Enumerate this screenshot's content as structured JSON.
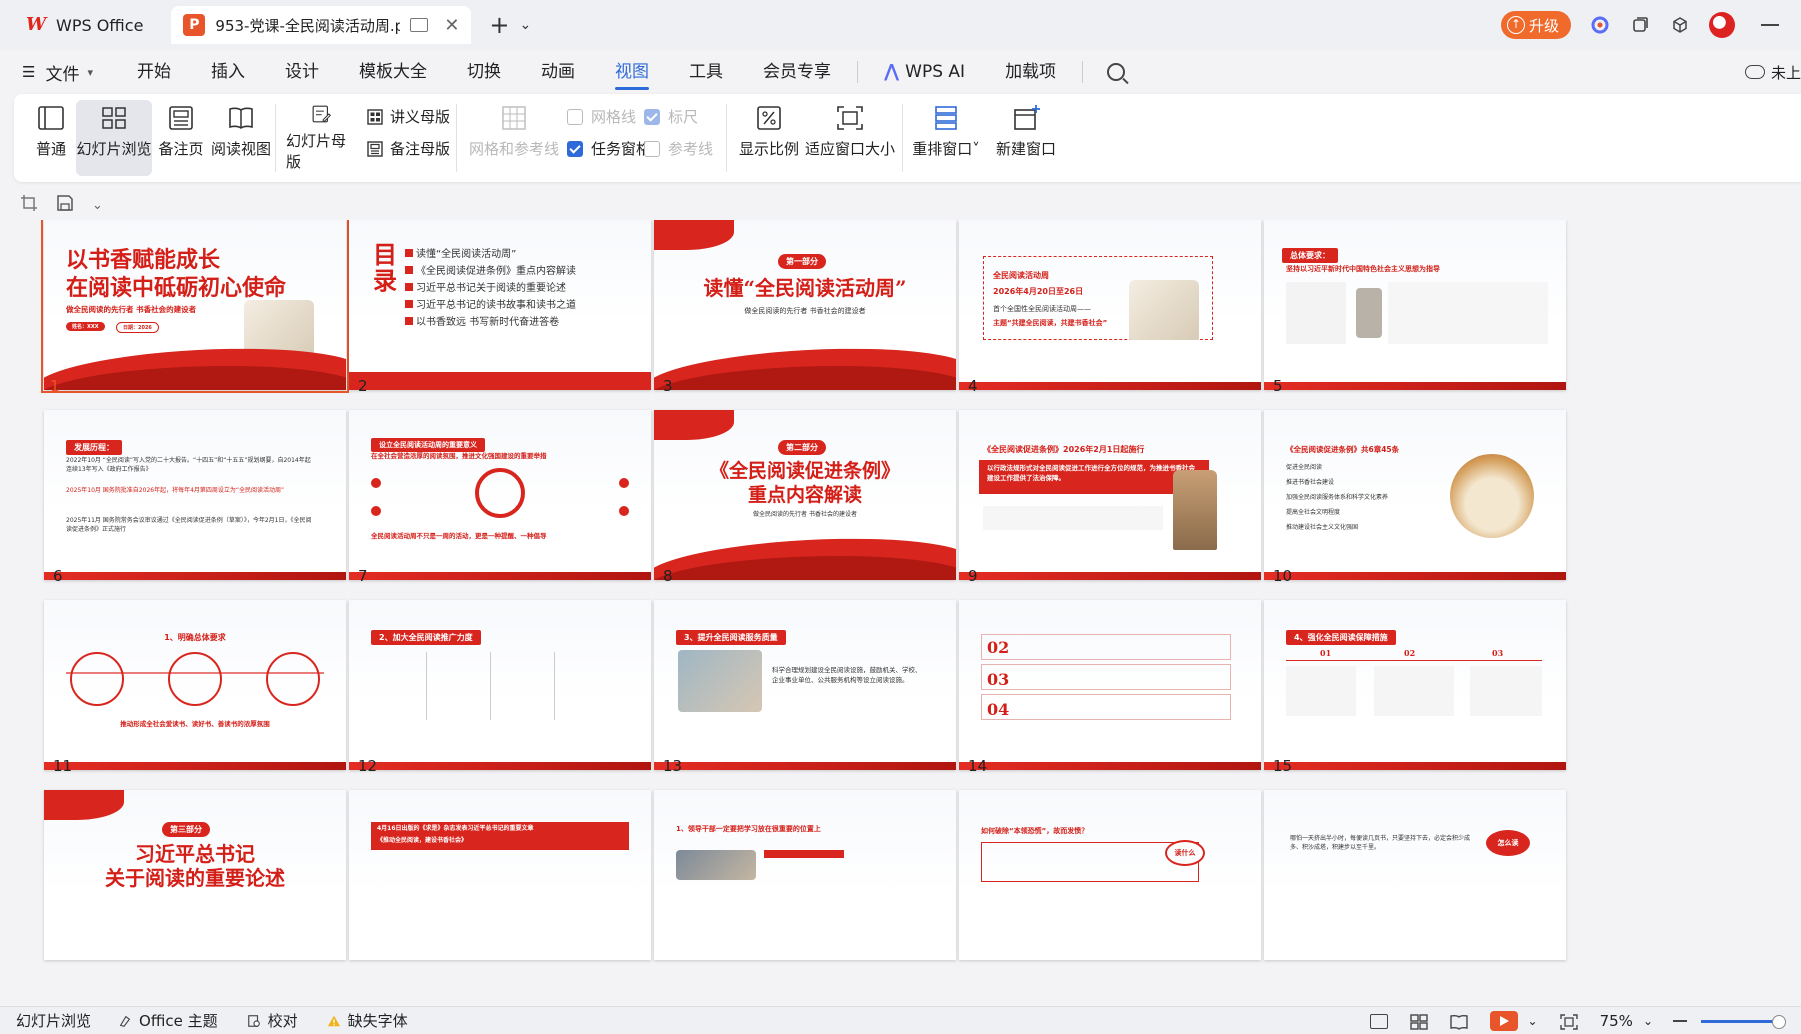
{
  "titlebar": {
    "home_tab": "WPS Office",
    "doc_tab": "953-党课-全民阅读活动周.p",
    "upgrade": "升级"
  },
  "menu": {
    "file": "文件",
    "items": [
      "开始",
      "插入",
      "设计",
      "模板大全",
      "切换",
      "动画",
      "视图",
      "工具",
      "会员专享"
    ],
    "active": "视图",
    "wps_ai": "WPS AI",
    "addons": "加载项",
    "right_label": "未上"
  },
  "ribbon": {
    "normal": "普通",
    "slide_browse": "幻灯片浏览",
    "notes_page": "备注页",
    "reading_view": "阅读视图",
    "slide_master": "幻灯片母版",
    "handout_master": "讲义母版",
    "notes_master": "备注母版",
    "grid_guides": "网格和参考线",
    "gridlines": "网格线",
    "ruler": "标尺",
    "task_pane": "任务窗格",
    "guides": "参考线",
    "zoom_ratio": "显示比例",
    "fit_window": "适应窗口大小",
    "rearrange": "重排窗口",
    "new_window": "新建窗口"
  },
  "slides": [
    {
      "num": "1",
      "title1": "以书香赋能成长",
      "title2": "在阅读中砥砺初心使命",
      "sub": "做全民阅读的先行者 书香社会的建设者",
      "tag1": "姓名：XXX",
      "tag2": "日期：2026"
    },
    {
      "num": "2",
      "title": "目录",
      "items": [
        "读懂“全民阅读活动周”",
        "《全民阅读促进条例》重点内容解读",
        "习近平总书记关于阅读的重要论述",
        "习近平总书记的读书故事和读书之道",
        "以书香致远 书写新时代奋进答卷"
      ]
    },
    {
      "num": "3",
      "part": "第一部分",
      "title": "读懂“全民阅读活动周”",
      "sub": "做全民阅读的先行者 书香社会的建设者"
    },
    {
      "num": "4",
      "head": "全民阅读活动周",
      "date": "2026年4月20日至26日",
      "line1": "首个全国性全民阅读活动周——",
      "line2": "主题“共建全民阅读，共建书香社会”"
    },
    {
      "num": "5",
      "head": "总体要求：",
      "sub": "坚持以习近平新时代中国特色社会主义思想为指导"
    },
    {
      "num": "6",
      "head": "发展历程：",
      "e1": "2022年10月 “全民阅读”写入党的二十大报告。“十四五”和“十五五”规划纲要，自2014年起连续13年写入《政府工作报告》",
      "e2": "2025年10月 国务院批准自2026年起，将每年4月第四周设立为“全民阅读活动周”",
      "e3": "2025年11月 国务院常务会议审议通过《全民阅读促进条例（草案）》，今年2月1日，《全民阅读促进条例》正式施行"
    },
    {
      "num": "7",
      "head": "设立全民阅读活动周的重要意义",
      "sub": "在全社会营造浓厚的阅读氛围，推进文化强国建设的重要举措",
      "foot": "全民阅读活动周不只是一周的活动，更是一种提醒、一种倡导"
    },
    {
      "num": "8",
      "part": "第二部分",
      "title1": "《全民阅读促进条例》",
      "title2": "重点内容解读",
      "sub": "做全民阅读的先行者 书香社会的建设者"
    },
    {
      "num": "9",
      "head": "《全民阅读促进条例》2026年2月1日起施行",
      "band": "以行政法规形式对全民阅读促进工作进行全方位的规范，为推进书香社会建设工作提供了法治保障。"
    },
    {
      "num": "10",
      "head": "《全民阅读促进条例》共6章45条",
      "items": [
        "促进全民阅读",
        "推进书香社会建设",
        "加强全民阅读服务体系和科学文化素养",
        "提高全社会文明程度",
        "推动建设社会主义文化强国"
      ]
    },
    {
      "num": "11",
      "head": "1、明确总体要求",
      "foot": "推动形成全社会爱读书、读好书、善读书的浓厚氛围"
    },
    {
      "num": "12",
      "head": "2、加大全民阅读推广力度"
    },
    {
      "num": "13",
      "head": "3、提升全民阅读服务质量",
      "body": "科学合理规划建设全民阅读设施，鼓励机关、学校、企业事业单位、公共服务机构等设立阅读设施。"
    },
    {
      "num": "14",
      "n1": "02",
      "n2": "03",
      "n3": "04"
    },
    {
      "num": "15",
      "head": "4、强化全民阅读保障措施",
      "n1": "01",
      "n2": "02",
      "n3": "03"
    },
    {
      "num": "16",
      "part": "第三部分",
      "title1": "习近平总书记",
      "title2": "关于阅读的重要论述"
    },
    {
      "num": "17",
      "head": "4月16日出版的《求是》杂志发表习近平总书记的重要文章",
      "sub": "《推动全民阅读，建设书香社会》"
    },
    {
      "num": "18",
      "head": "1、领导干部一定要把学习放在很重要的位置上"
    },
    {
      "num": "19",
      "head": "如何破除“本领恐慌”，故而发愤？",
      "tag": "读什么"
    },
    {
      "num": "20",
      "body": "哪怕一天挤出半小时，每便读几页书，只要坚持下去，必定会积少成多、积沙成塔，积建步以至千里。",
      "tag": "怎么读"
    }
  ],
  "statusbar": {
    "view_name": "幻灯片浏览",
    "theme": "Office 主题",
    "proofread": "校对",
    "missing_font": "缺失字体",
    "zoom": "75%"
  },
  "colors": {
    "accent_blue": "#2f6bd8",
    "slide_red": "#d41f18",
    "wps_orange": "#e8552b"
  }
}
